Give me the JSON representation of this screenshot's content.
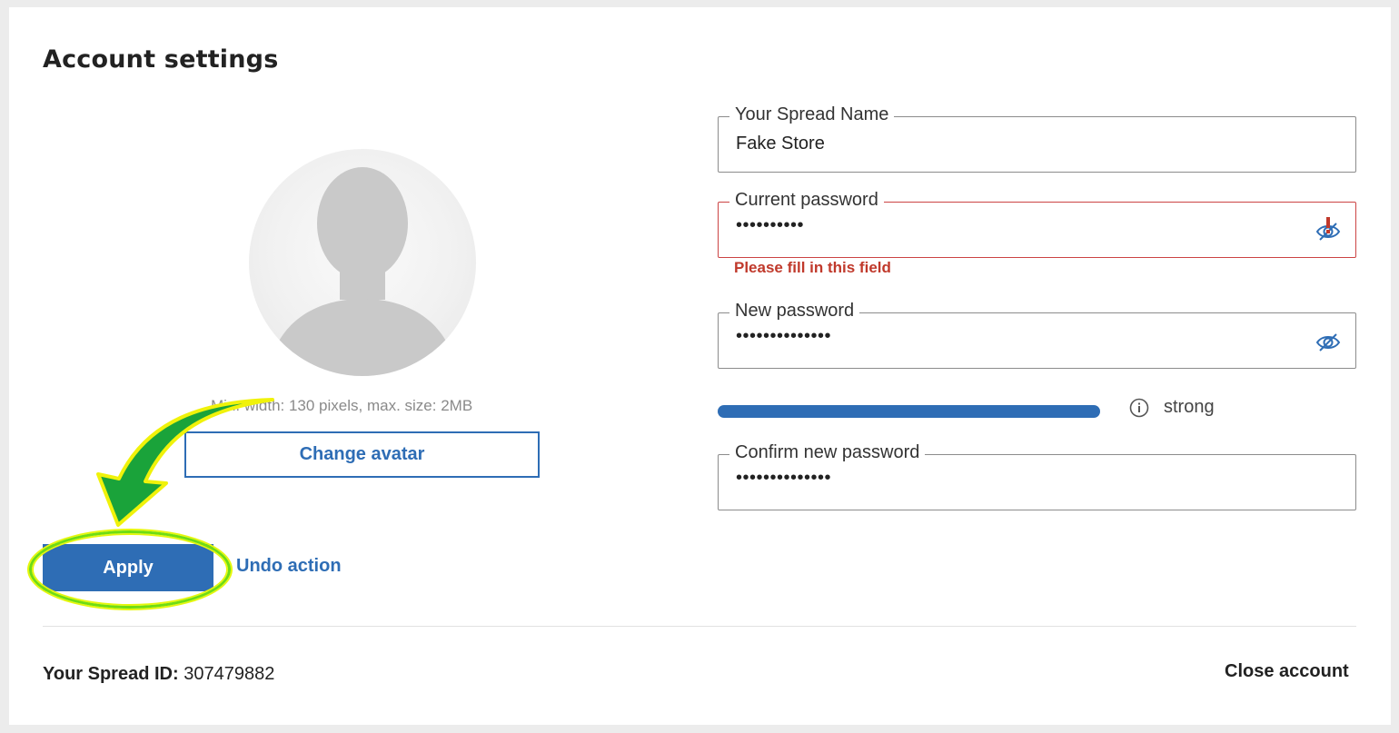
{
  "page": {
    "title": "Account settings"
  },
  "avatar": {
    "hint": "Min. width: 130 pixels, max. size: 2MB",
    "change_label": "Change avatar"
  },
  "actions": {
    "apply_label": "Apply",
    "undo_label": "Undo action"
  },
  "form": {
    "spread_name": {
      "label": "Your Spread Name",
      "value": "Fake Store"
    },
    "current_password": {
      "label": "Current password",
      "value": "••••••••••",
      "error": "Please fill in this field"
    },
    "new_password": {
      "label": "New password",
      "value": "••••••••••••••"
    },
    "strength": {
      "text": "strong",
      "level": 1.0
    },
    "confirm_password": {
      "label": "Confirm new password",
      "value": "••••••••••••••"
    }
  },
  "footer": {
    "spread_id_label": "Your Spread ID:",
    "spread_id_value": "307479882",
    "close_account_label": "Close account"
  },
  "colors": {
    "accent": "#2e6db5",
    "error": "#c0392b",
    "highlight_green": "#6fdc12",
    "highlight_yellow": "#f0f20a",
    "arrow_green": "#1aa33a"
  },
  "icons": {
    "eye": "eye-slash-icon",
    "info": "info-icon",
    "error": "exclamation-icon"
  }
}
